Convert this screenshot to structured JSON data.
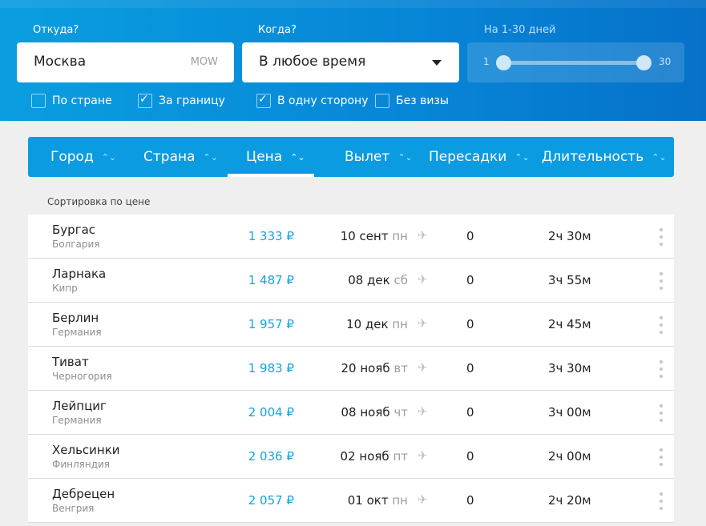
{
  "filters": {
    "from_label": "Откуда?",
    "from_value": "Москва",
    "from_code": "MOW",
    "when_label": "Когда?",
    "when_value": "В любое время",
    "days_label": "На 1-30 дней",
    "days_min": "1",
    "days_max": "30",
    "checkboxes": [
      {
        "label": "По стране",
        "checked": false
      },
      {
        "label": "За границу",
        "checked": true
      },
      {
        "label": "В одну сторону",
        "checked": true
      },
      {
        "label": "Без визы",
        "checked": false
      }
    ]
  },
  "sort": {
    "columns": [
      "Город",
      "Страна",
      "Цена",
      "Вылет",
      "Пересадки",
      "Длительность"
    ],
    "active": "Цена",
    "note": "Сортировка по цене"
  },
  "flights": [
    {
      "city": "Бургас",
      "country": "Болгария",
      "price": "1 333 ₽",
      "date": "10 сент",
      "weekday": "пн",
      "stops": "0",
      "duration": "2ч 30м"
    },
    {
      "city": "Ларнака",
      "country": "Кипр",
      "price": "1 487 ₽",
      "date": "08 дек",
      "weekday": "сб",
      "stops": "0",
      "duration": "3ч 55м"
    },
    {
      "city": "Берлин",
      "country": "Германия",
      "price": "1 957 ₽",
      "date": "10 дек",
      "weekday": "пн",
      "stops": "0",
      "duration": "2ч 45м"
    },
    {
      "city": "Тиват",
      "country": "Черногория",
      "price": "1 983 ₽",
      "date": "20 нояб",
      "weekday": "вт",
      "stops": "0",
      "duration": "3ч 30м"
    },
    {
      "city": "Лейпциг",
      "country": "Германия",
      "price": "2 004 ₽",
      "date": "08 нояб",
      "weekday": "чт",
      "stops": "0",
      "duration": "3ч 00м"
    },
    {
      "city": "Хельсинки",
      "country": "Финляндия",
      "price": "2 036 ₽",
      "date": "02 нояб",
      "weekday": "пт",
      "stops": "0",
      "duration": "2ч 00м"
    },
    {
      "city": "Дебрецен",
      "country": "Венгрия",
      "price": "2 057 ₽",
      "date": "01 окт",
      "weekday": "пн",
      "stops": "0",
      "duration": "2ч 20м"
    }
  ],
  "icons": {
    "plane": "plane-icon",
    "more": "more-vertical-icon",
    "dropdown": "caret-down-icon",
    "sort": "sort-chevron-icon"
  },
  "colors": {
    "accent": "#0a9be0",
    "price": "#1aa3dc"
  }
}
